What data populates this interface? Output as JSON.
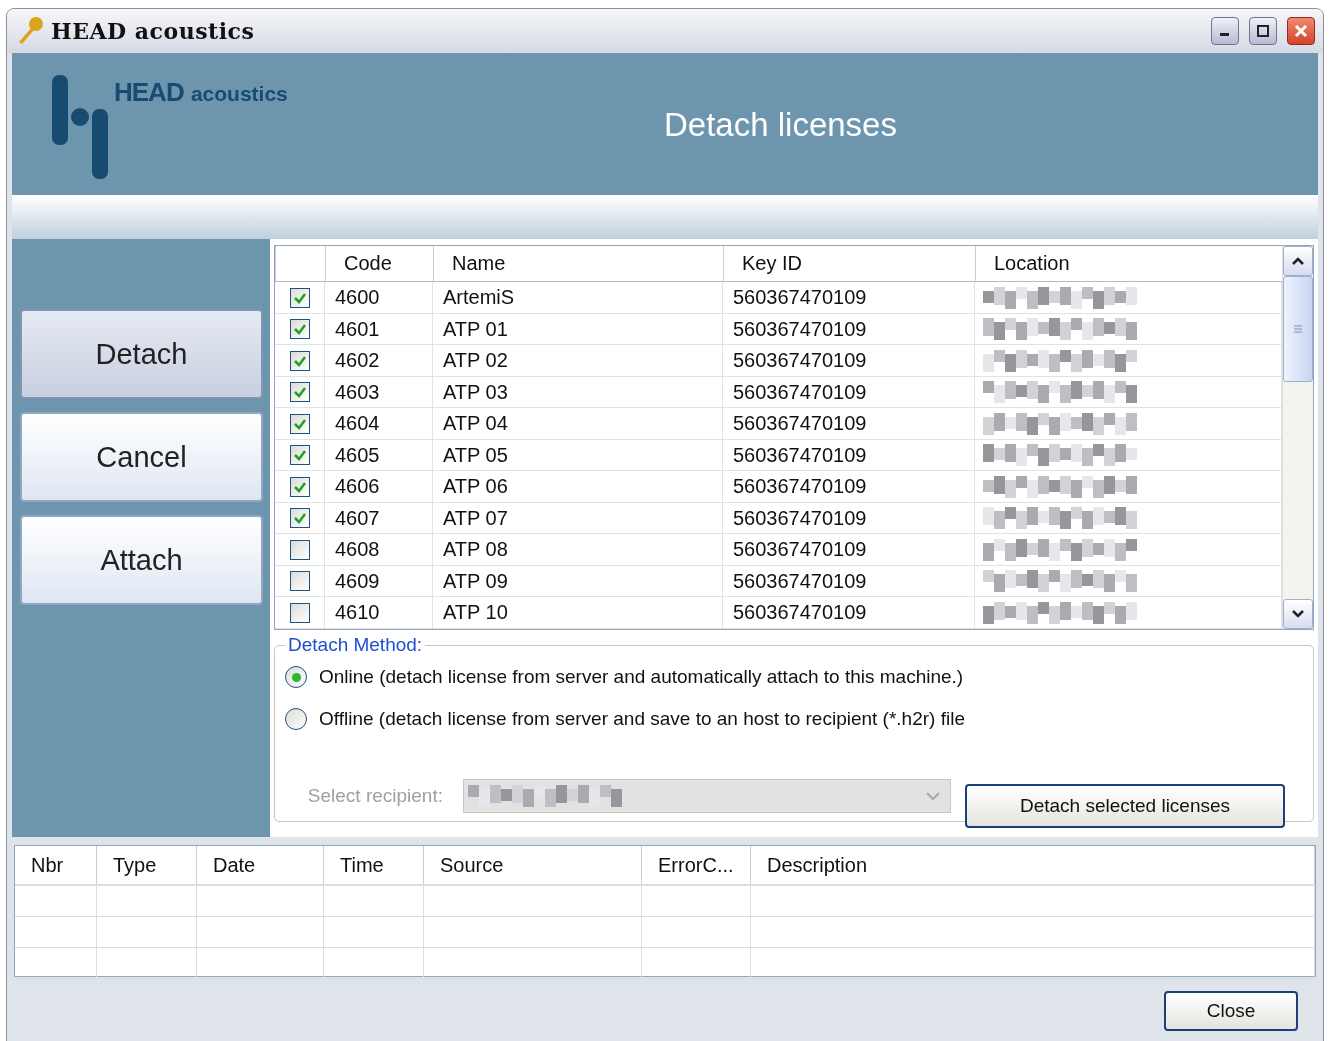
{
  "window": {
    "title": "HEAD acoustics"
  },
  "header": {
    "logo_bold": "HEAD",
    "logo_light": "acoustics",
    "title": "Detach licenses"
  },
  "nav_buttons": [
    {
      "label": "Detach",
      "selected": true
    },
    {
      "label": "Cancel",
      "selected": false
    },
    {
      "label": "Attach",
      "selected": false
    }
  ],
  "licenses": {
    "columns": [
      "Code",
      "Name",
      "Key ID",
      "Location"
    ],
    "rows": [
      {
        "checked": true,
        "code": "4600",
        "name": "ArtemiS",
        "key_id": "560367470109"
      },
      {
        "checked": true,
        "code": "4601",
        "name": "ATP 01",
        "key_id": "560367470109"
      },
      {
        "checked": true,
        "code": "4602",
        "name": "ATP 02",
        "key_id": "560367470109"
      },
      {
        "checked": true,
        "code": "4603",
        "name": "ATP 03",
        "key_id": "560367470109"
      },
      {
        "checked": true,
        "code": "4604",
        "name": "ATP 04",
        "key_id": "560367470109"
      },
      {
        "checked": true,
        "code": "4605",
        "name": "ATP 05",
        "key_id": "560367470109"
      },
      {
        "checked": true,
        "code": "4606",
        "name": "ATP 06",
        "key_id": "560367470109"
      },
      {
        "checked": true,
        "code": "4607",
        "name": "ATP 07",
        "key_id": "560367470109"
      },
      {
        "checked": false,
        "code": "4608",
        "name": "ATP 08",
        "key_id": "560367470109"
      },
      {
        "checked": false,
        "code": "4609",
        "name": "ATP 09",
        "key_id": "560367470109"
      },
      {
        "checked": false,
        "code": "4610",
        "name": "ATP 10",
        "key_id": "560367470109"
      }
    ]
  },
  "detach_method": {
    "legend": "Detach Method:",
    "options": [
      {
        "label": "Online (detach license from server and automatically attach to this machine.)",
        "selected": true
      },
      {
        "label": "Offline (detach license from server and save to an host to recipient (*.h2r) file",
        "selected": false
      }
    ],
    "recipient_label": "Select recipient:",
    "recipient_disabled": true,
    "button": "Detach selected licenses"
  },
  "log": {
    "columns": [
      "Nbr",
      "Type",
      "Date",
      "Time",
      "Source",
      "ErrorC...",
      "Description"
    ]
  },
  "close_button": "Close"
}
